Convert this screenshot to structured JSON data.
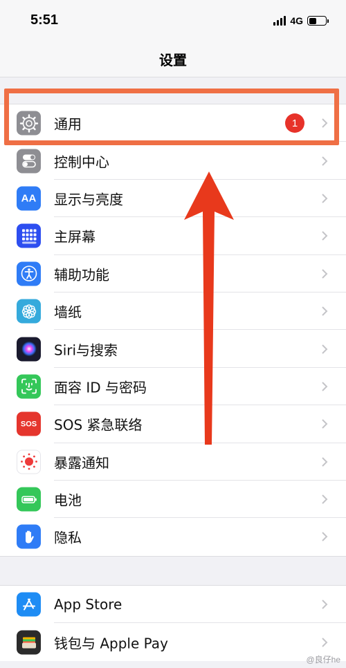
{
  "status_bar": {
    "time": "5:51",
    "network": "4G",
    "battery_level": 45
  },
  "nav": {
    "title": "设置"
  },
  "group1": [
    {
      "label": "通用",
      "icon": "gear-icon",
      "color": "#8e8e93",
      "badge": "1"
    },
    {
      "label": "控制中心",
      "icon": "toggle-switches-icon",
      "color": "#8e8e93"
    },
    {
      "label": "显示与亮度",
      "icon": "text-size-icon",
      "color": "#2f7cf6",
      "icon_text": "AA"
    },
    {
      "label": "主屏幕",
      "icon": "home-screen-grid-icon",
      "color": "#2d4ef0"
    },
    {
      "label": "辅助功能",
      "icon": "accessibility-icon",
      "color": "#2f7cf6"
    },
    {
      "label": "墙纸",
      "icon": "flower-icon",
      "color": "#35aadc"
    },
    {
      "label": "Siri与搜索",
      "icon": "siri-icon",
      "color": "#1a1a2e"
    },
    {
      "label": "面容 ID 与密码",
      "icon": "face-id-icon",
      "color": "#34c759"
    },
    {
      "label": "SOS 紧急联络",
      "icon": "sos-icon",
      "color": "#e5352d",
      "icon_text": "SOS"
    },
    {
      "label": "暴露通知",
      "icon": "exposure-notification-icon",
      "color": "#ffffff"
    },
    {
      "label": "电池",
      "icon": "battery-icon",
      "color": "#34c759"
    },
    {
      "label": "隐私",
      "icon": "hand-icon",
      "color": "#2f7cf6"
    }
  ],
  "group2": [
    {
      "label": "App Store",
      "icon": "app-store-icon",
      "color": "#1e8cf4"
    },
    {
      "label": "钱包与 Apple Pay",
      "icon": "wallet-icon",
      "color": "#2b2b2b"
    }
  ],
  "watermark": "@良仔he"
}
